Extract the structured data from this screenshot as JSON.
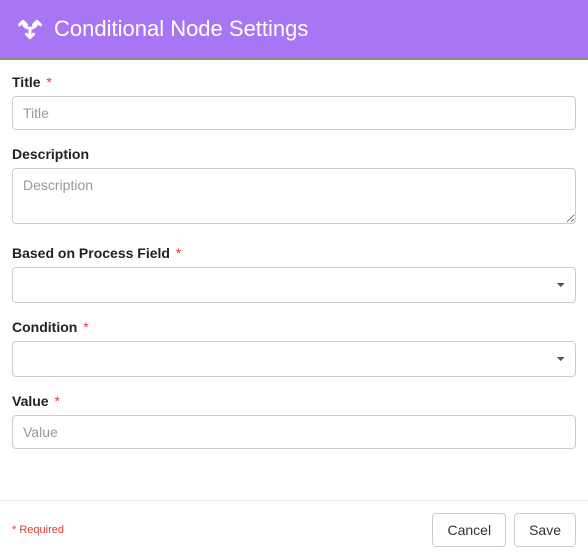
{
  "header": {
    "title": "Conditional Node Settings",
    "icon": "fork-icon"
  },
  "form": {
    "title": {
      "label": "Title",
      "required": true,
      "placeholder": "Title",
      "value": ""
    },
    "description": {
      "label": "Description",
      "required": false,
      "placeholder": "Description",
      "value": ""
    },
    "processField": {
      "label": "Based on Process Field",
      "required": true,
      "value": ""
    },
    "condition": {
      "label": "Condition",
      "required": true,
      "value": ""
    },
    "value": {
      "label": "Value",
      "required": true,
      "placeholder": "Value",
      "value": ""
    }
  },
  "footer": {
    "requiredNote": "* Required",
    "cancel": "Cancel",
    "save": "Save"
  },
  "requiredMark": "*"
}
